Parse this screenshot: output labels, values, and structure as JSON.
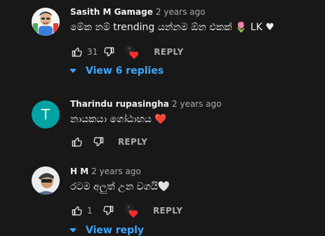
{
  "colors": {
    "background": "#181818",
    "text": "#f1f1f1",
    "muted": "#aaaaaa",
    "link": "#3ea6ff",
    "heart": "#ff2d2d",
    "avatar_t": "#00a3a3"
  },
  "comments": [
    {
      "author": "Sasith M Gamage",
      "time": "2 years ago",
      "text": "මේක නම් trending යන්නම ඕන එකක් 🌷 LK ♥",
      "likes": "31",
      "reply_label": "REPLY",
      "hearted": true,
      "replies_toggle": "View 6 replies",
      "avatar_icon": "cartoon-avatar-icon"
    },
    {
      "author": "Tharindu rupasingha",
      "time": "2 years ago",
      "text": "නායකයා ගෝඨාභය ❤️",
      "likes": "",
      "reply_label": "REPLY",
      "hearted": false,
      "avatar_letter": "T"
    },
    {
      "author": "H M",
      "time": "2 years ago",
      "text": "රටම අලුත් උන වගයි🤍",
      "likes": "1",
      "reply_label": "REPLY",
      "hearted": true,
      "replies_toggle": "View reply",
      "avatar_icon": "photo-avatar-icon"
    }
  ]
}
